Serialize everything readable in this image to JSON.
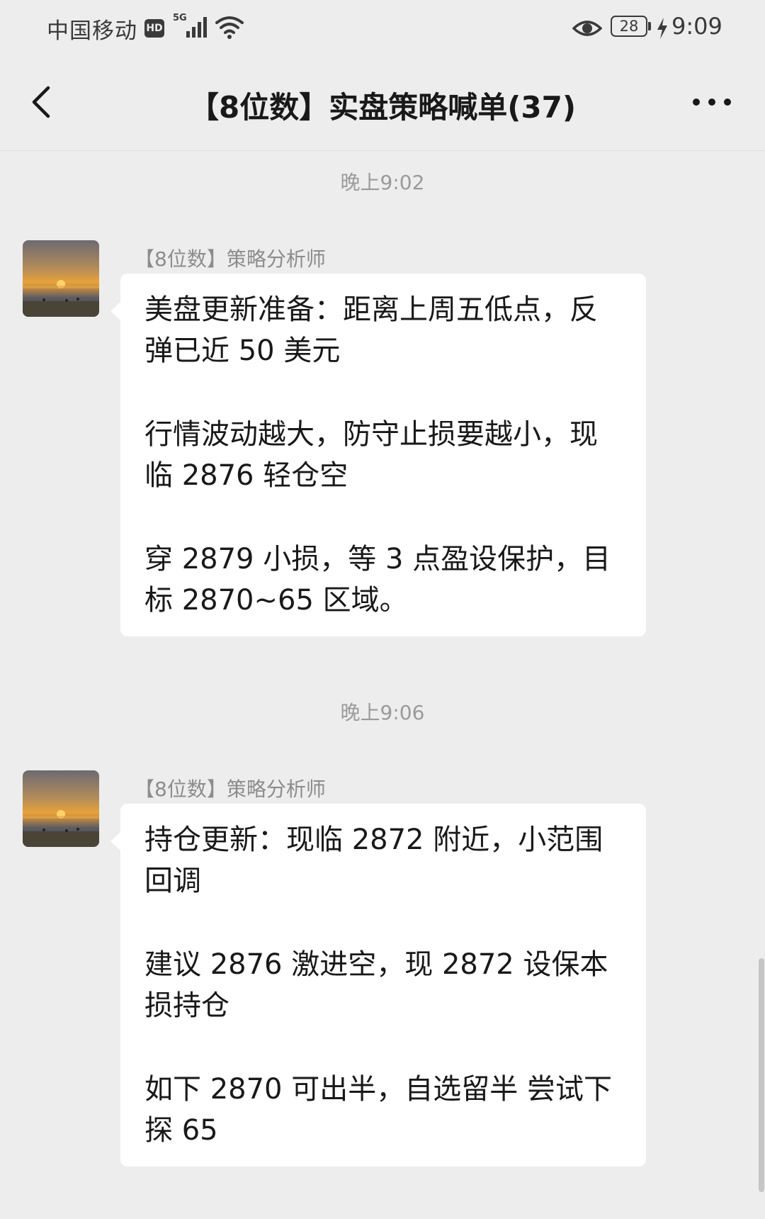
{
  "status_bar": {
    "carrier": "中国移动",
    "hd_badge": "HD",
    "network": "5G",
    "battery_level": "28",
    "time": "9:09"
  },
  "header": {
    "title": "【8位数】实盘策略喊单(37)",
    "back_icon": "chevron-left-icon",
    "more_icon": "more-dots-icon"
  },
  "messages": [
    {
      "timestamp": "晚上9:02",
      "sender": "【8位数】策略分析师",
      "paragraphs": [
        "美盘更新准备：距离上周五低点，反弹已近 50 美元",
        "行情波动越大，防守止损要越小，现临 2876 轻仓空",
        "穿 2879 小损，等 3 点盈设保护，目标 2870~65 区域。"
      ]
    },
    {
      "timestamp": "晚上9:06",
      "sender": "【8位数】策略分析师",
      "paragraphs": [
        "持仓更新：现临 2872 附近，小范围回调",
        "建议 2876 激进空，现 2872 设保本损持仓",
        "如下 2870 可出半，自选留半 尝试下探 65"
      ]
    }
  ]
}
